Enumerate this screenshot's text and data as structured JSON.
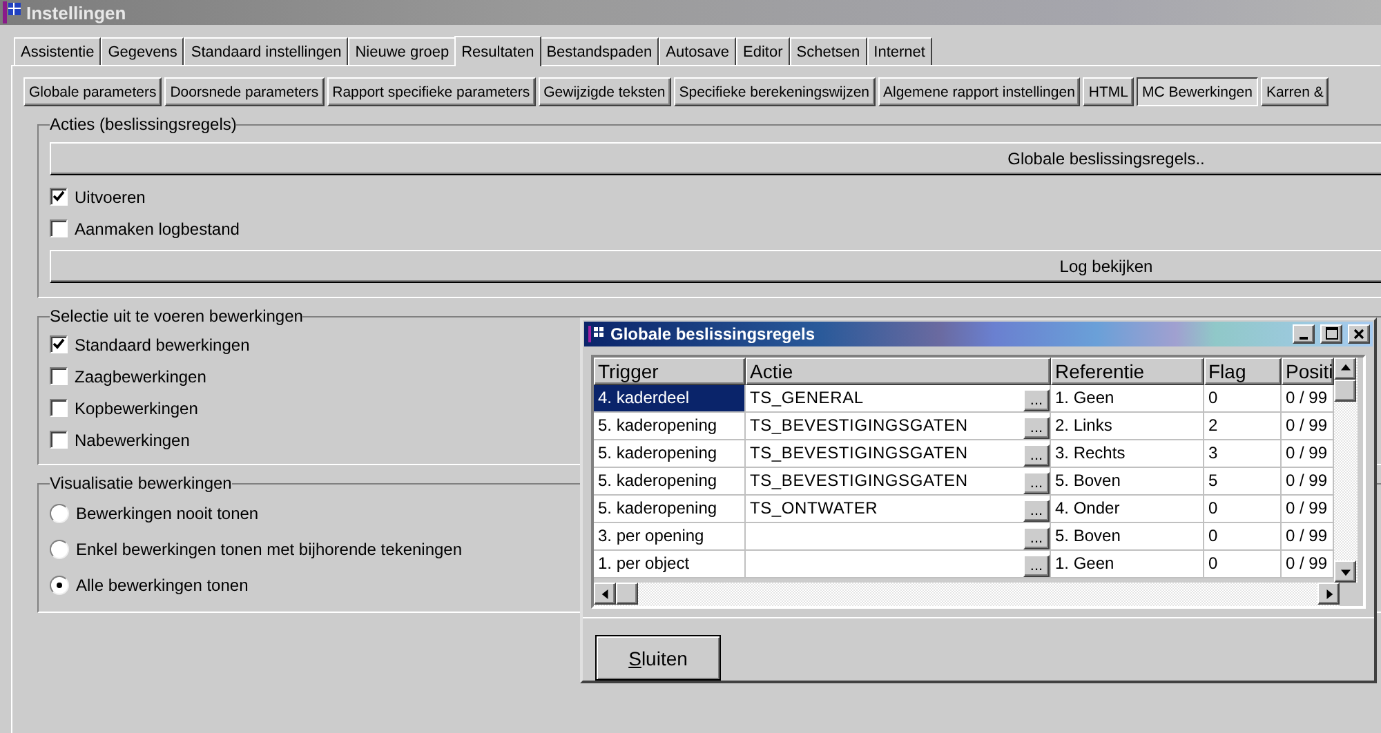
{
  "window": {
    "title": "Instellingen"
  },
  "tabs": [
    {
      "label": "Assistentie",
      "selected": false
    },
    {
      "label": "Gegevens",
      "selected": false
    },
    {
      "label": "Standaard instellingen",
      "selected": false
    },
    {
      "label": "Nieuwe groep",
      "selected": false
    },
    {
      "label": "Resultaten",
      "selected": true
    },
    {
      "label": "Bestandspaden",
      "selected": false
    },
    {
      "label": "Autosave",
      "selected": false
    },
    {
      "label": "Editor",
      "selected": false
    },
    {
      "label": "Schetsen",
      "selected": false
    },
    {
      "label": "Internet",
      "selected": false
    }
  ],
  "subtabs": [
    {
      "label": "Globale parameters",
      "selected": false
    },
    {
      "label": "Doorsnede parameters",
      "selected": false
    },
    {
      "label": "Rapport specifieke parameters",
      "selected": false
    },
    {
      "label": "Gewijzigde teksten",
      "selected": false
    },
    {
      "label": "Specifieke berekeningswijzen",
      "selected": false
    },
    {
      "label": "Algemene rapport instellingen",
      "selected": false
    },
    {
      "label": "HTML",
      "selected": false
    },
    {
      "label": "MC Bewerkingen",
      "selected": true
    },
    {
      "label": "Karren &",
      "selected": false
    }
  ],
  "groups": [
    {
      "title": "Acties (beslissingsregels)",
      "items": [
        {
          "kind": "button",
          "label": "Globale beslissingsregels.."
        },
        {
          "kind": "checkbox",
          "label": "Uitvoeren",
          "checked": true
        },
        {
          "kind": "checkbox",
          "label": "Aanmaken logbestand",
          "checked": false
        },
        {
          "kind": "button",
          "label": "Log bekijken"
        }
      ]
    },
    {
      "title": "Selectie uit te voeren bewerkingen",
      "items": [
        {
          "kind": "checkbox",
          "label": "Standaard bewerkingen",
          "checked": true
        },
        {
          "kind": "checkbox",
          "label": "Zaagbewerkingen",
          "checked": false
        },
        {
          "kind": "checkbox",
          "label": "Kopbewerkingen",
          "checked": false
        },
        {
          "kind": "checkbox",
          "label": "Nabewerkingen",
          "checked": false
        }
      ]
    },
    {
      "title": "Visualisatie bewerkingen",
      "items": [
        {
          "kind": "radio",
          "label": "Bewerkingen nooit tonen",
          "selected": false
        },
        {
          "kind": "radio",
          "label": "Enkel bewerkingen tonen met bijhorende tekeningen",
          "selected": false
        },
        {
          "kind": "radio",
          "label": "Alle bewerkingen tonen",
          "selected": true
        }
      ]
    }
  ],
  "dialog": {
    "title": "Globale beslissingsregels",
    "columns": [
      "Trigger",
      "Actie",
      "Referentie",
      "Flag",
      "Positi"
    ],
    "rows": [
      {
        "trigger": "4. kaderdeel",
        "actie": "TS_GENERAL",
        "referentie": "1. Geen",
        "flag": "0",
        "positie": "0 / 99",
        "selected": true
      },
      {
        "trigger": "5. kaderopening",
        "actie": "TS_BEVESTIGINGSGATEN",
        "referentie": "2. Links",
        "flag": "2",
        "positie": "0 / 99",
        "selected": false
      },
      {
        "trigger": "5. kaderopening",
        "actie": "TS_BEVESTIGINGSGATEN",
        "referentie": "3. Rechts",
        "flag": "3",
        "positie": "0 / 99",
        "selected": false
      },
      {
        "trigger": "5. kaderopening",
        "actie": "TS_BEVESTIGINGSGATEN",
        "referentie": "5. Boven",
        "flag": "5",
        "positie": "0 / 99",
        "selected": false
      },
      {
        "trigger": "5. kaderopening",
        "actie": "TS_ONTWATER",
        "referentie": "4. Onder",
        "flag": "0",
        "positie": "0 / 99",
        "selected": false
      },
      {
        "trigger": "3. per opening",
        "actie": "",
        "referentie": "5. Boven",
        "flag": "0",
        "positie": "0 / 99",
        "selected": false
      },
      {
        "trigger": "1. per object",
        "actie": "",
        "referentie": "1. Geen",
        "flag": "0",
        "positie": "0 / 99",
        "selected": false
      }
    ],
    "ellipsis": "...",
    "close_button": "Sluiten"
  }
}
